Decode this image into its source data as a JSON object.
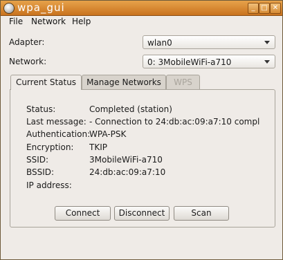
{
  "window": {
    "title": "wpa_gui",
    "minimize": "_",
    "maximize": "□",
    "close": "✕"
  },
  "menu": {
    "file": "File",
    "network": "Network",
    "help": "Help"
  },
  "adapter": {
    "label": "Adapter:",
    "value": "wlan0"
  },
  "network": {
    "label": "Network:",
    "value": "0: 3MobileWiFi-a710"
  },
  "tabs": [
    {
      "label": "Current Status",
      "state": "active"
    },
    {
      "label": "Manage Networks",
      "state": "inactive"
    },
    {
      "label": "WPS",
      "state": "disabled"
    }
  ],
  "status": {
    "status_label": "Status:",
    "status_value": "Completed (station)",
    "last_message_label": "Last message:",
    "last_message_value": "- Connection to 24:db:ac:09:a7:10 comple",
    "auth_label": "Authentication:",
    "auth_value": "WPA-PSK",
    "encryption_label": "Encryption:",
    "encryption_value": "TKIP",
    "ssid_label": "SSID:",
    "ssid_value": "3MobileWiFi-a710",
    "bssid_label": "BSSID:",
    "bssid_value": "24:db:ac:09:a7:10",
    "ip_label": "IP address:",
    "ip_value": ""
  },
  "buttons": {
    "connect": "Connect",
    "disconnect": "Disconnect",
    "scan": "Scan"
  },
  "colors": {
    "titlebar": "#d98a35",
    "window_bg": "#efebe7",
    "border": "#a8a39a"
  }
}
